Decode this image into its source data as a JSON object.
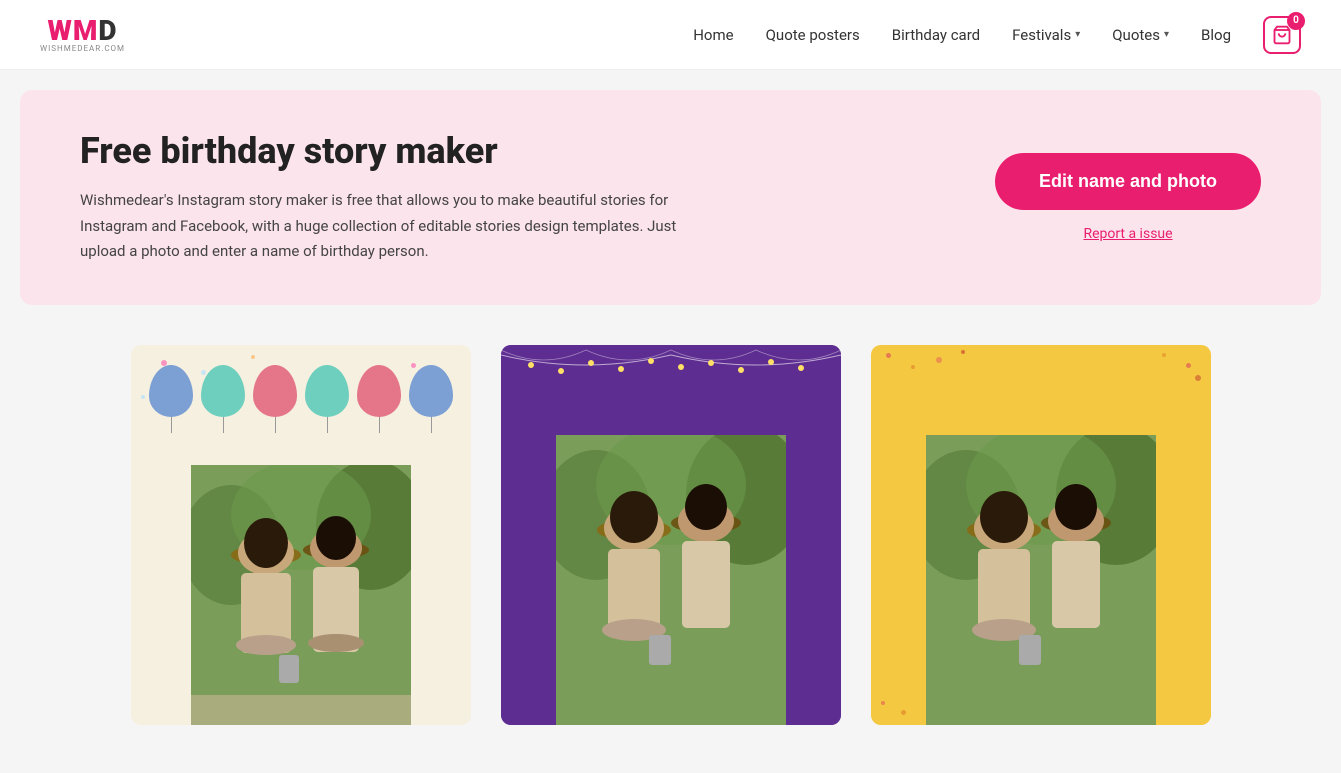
{
  "header": {
    "logo_main": "WMD",
    "logo_sub": "WISHMEDEAR.COM",
    "nav": {
      "home": "Home",
      "quote_posters": "Quote posters",
      "birthday_card": "Birthday card",
      "festivals": "Festivals",
      "quotes": "Quotes",
      "blog": "Blog"
    },
    "cart_count": "0"
  },
  "hero": {
    "title": "Free birthday story maker",
    "description": "Wishmedear's Instagram story maker is free that allows you to make beautiful stories for Instagram and Facebook, with a huge collection of editable stories design templates. Just upload a photo and enter a name of birthday person.",
    "cta_button": "Edit name and photo",
    "report_link": "Report a issue"
  },
  "cards": [
    {
      "id": "card-1",
      "theme": "balloons-light",
      "bg_color": "#f5f0e0"
    },
    {
      "id": "card-2",
      "theme": "purple-lights",
      "bg_color": "#5e2d91"
    },
    {
      "id": "card-3",
      "theme": "yellow-dots",
      "bg_color": "#f5c842"
    }
  ],
  "colors": {
    "brand_pink": "#e91e6e",
    "hero_bg": "#fce4ec",
    "card1_bg": "#f5f0e0",
    "card2_bg": "#5e2d91",
    "card3_bg": "#f5c842"
  }
}
